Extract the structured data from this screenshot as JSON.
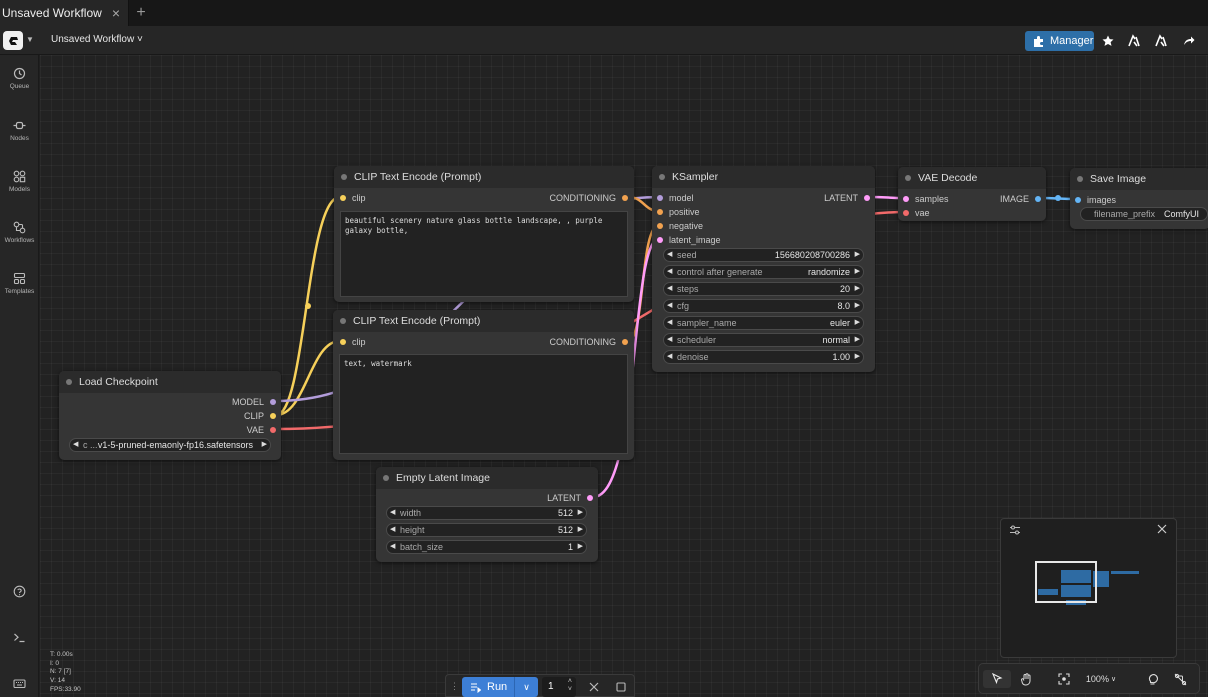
{
  "tabs": [
    {
      "label": "Unsaved Workflow",
      "close": "×"
    }
  ],
  "tab_add": "+",
  "topbar": {
    "workflow_menu": "Unsaved Workflow ˅",
    "manager_label": "Manager",
    "icons": [
      "star-icon",
      "download-icon",
      "upload-icon",
      "share-icon"
    ]
  },
  "sidebar": {
    "items": [
      {
        "label": "Queue",
        "icon": "history-icon"
      },
      {
        "label": "Nodes",
        "icon": "node-icon"
      },
      {
        "label": "Models",
        "icon": "models-icon"
      },
      {
        "label": "Workflows",
        "icon": "workflow-icon"
      },
      {
        "label": "Templates",
        "icon": "templates-icon"
      }
    ],
    "bottom_icons": [
      "help-icon",
      "terminal-icon",
      "keyboard-icon"
    ]
  },
  "nodes": {
    "clip1": {
      "title": "CLIP Text Encode (Prompt)",
      "input": "clip",
      "output": "CONDITIONING",
      "text": "beautiful scenery nature glass bottle landscape, , purple galaxy bottle,"
    },
    "clip2": {
      "title": "CLIP Text Encode (Prompt)",
      "input": "clip",
      "output": "CONDITIONING",
      "text": "text, watermark"
    },
    "ksampler": {
      "title": "KSampler",
      "inputs": [
        "model",
        "positive",
        "negative",
        "latent_image"
      ],
      "output": "LATENT",
      "widgets": [
        {
          "label": "seed",
          "value": "156680208700286"
        },
        {
          "label": "control after generate",
          "value": "randomize"
        },
        {
          "label": "steps",
          "value": "20"
        },
        {
          "label": "cfg",
          "value": "8.0"
        },
        {
          "label": "sampler_name",
          "value": "euler"
        },
        {
          "label": "scheduler",
          "value": "normal"
        },
        {
          "label": "denoise",
          "value": "1.00"
        }
      ]
    },
    "vae_decode": {
      "title": "VAE Decode",
      "inputs": [
        "samples",
        "vae"
      ],
      "output": "IMAGE"
    },
    "save_image": {
      "title": "Save Image",
      "input": "images",
      "widget": {
        "label": "filename_prefix",
        "value": "ComfyUI"
      }
    },
    "load_checkpoint": {
      "title": "Load Checkpoint",
      "outputs": [
        "MODEL",
        "CLIP",
        "VAE"
      ],
      "widget": {
        "label": "c ...",
        "value": "v1-5-pruned-emaonly-fp16.safetensors"
      }
    },
    "empty_latent": {
      "title": "Empty Latent Image",
      "output": "LATENT",
      "widgets": [
        {
          "label": "width",
          "value": "512"
        },
        {
          "label": "height",
          "value": "512"
        },
        {
          "label": "batch_size",
          "value": "1"
        }
      ]
    }
  },
  "wire_colors": {
    "clip": "#f6d05a",
    "conditioning": "#f2a24f",
    "model": "#b39ddb",
    "vae": "#f26a6a",
    "latent": "#ff9cf9",
    "image": "#64b5f6"
  },
  "run": {
    "label": "Run",
    "batch_count": "1"
  },
  "zoom": "100%",
  "stats": [
    "T: 0.00s",
    "I: 0",
    "N: 7 [7]",
    "V: 14",
    "FPS:33.90"
  ]
}
